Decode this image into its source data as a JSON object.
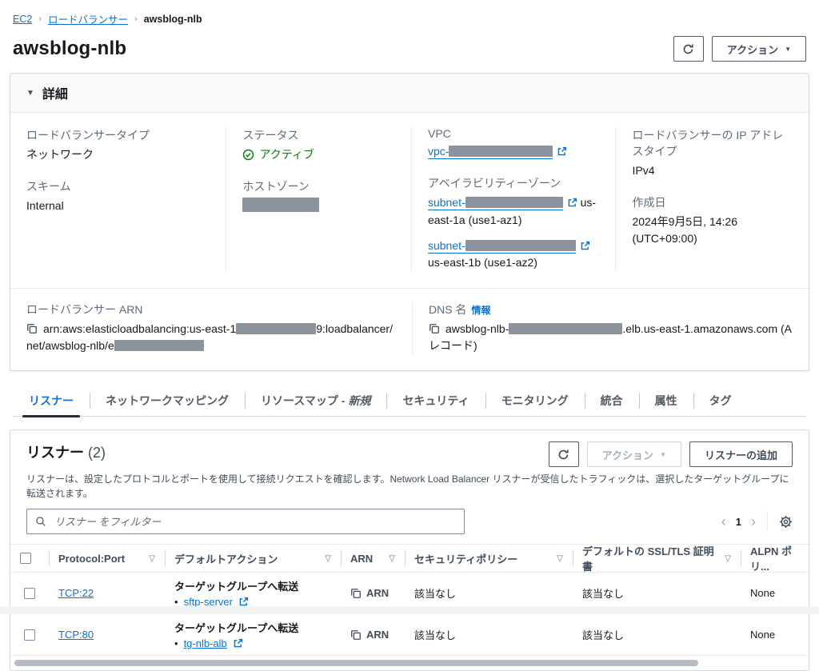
{
  "colors": {
    "link_blue": "#0972d3",
    "status_green": "#037f0c",
    "text_dark": "#16191f",
    "label_gray": "#5f6b7a",
    "border_gray": "#d5dbdb",
    "redact_gray": "#8c939c",
    "active_tab_underline": "#232f3e"
  },
  "icons": {
    "caret_down": "▼",
    "collapse_triangle": "▼",
    "sort_triangle": "▽",
    "breadcrumb_sep": "›",
    "bullet": "•",
    "chevron_left": "‹",
    "chevron_right": "›"
  },
  "breadcrumb": {
    "items": [
      "EC2",
      "ロードバランサー",
      "awsblog-nlb"
    ]
  },
  "header": {
    "title": "awsblog-nlb",
    "actions_button": "アクション"
  },
  "details": {
    "title": "詳細",
    "lb_type": {
      "label": "ロードバランサータイプ",
      "value": "ネットワーク"
    },
    "scheme": {
      "label": "スキーム",
      "value": "Internal"
    },
    "status": {
      "label": "ステータス",
      "value": "アクティブ"
    },
    "hosted_zone": {
      "label": "ホストゾーン"
    },
    "vpc": {
      "label": "VPC",
      "value_prefix": "vpc-"
    },
    "az": {
      "label": "アベイラビリティーゾーン",
      "subnet1_prefix": "subnet-",
      "subnet1_suffix": "us-east-1a (use1-az1)",
      "subnet2_prefix": "subnet-",
      "subnet2_suffix": "us-east-1b (use1-az2)"
    },
    "ip_type": {
      "label": "ロードバランサーの IP アドレスタイプ",
      "value": "IPv4"
    },
    "created": {
      "label": "作成日",
      "value": "2024年9月5日, 14:26 (UTC+09:00)"
    },
    "arn": {
      "label": "ロードバランサー ARN",
      "value_part1": "arn:aws:elasticloadbalancing:us-east-1",
      "value_part2": "9:loadbalancer/net/awsblog-nlb/e"
    },
    "dns": {
      "label": "DNS 名",
      "info_link": "情報",
      "value_prefix": "awsblog-nlb-",
      "value_suffix": ".elb.us-east-1.amazonaws.com (A レコード)"
    }
  },
  "tabs": [
    {
      "label": "リスナー"
    },
    {
      "label": "ネットワークマッピング"
    },
    {
      "label": "リソースマップ -",
      "label_em": "新規"
    },
    {
      "label": "セキュリティ"
    },
    {
      "label": "モニタリング"
    },
    {
      "label": "統合"
    },
    {
      "label": "属性"
    },
    {
      "label": "タグ"
    }
  ],
  "listeners": {
    "title": "リスナー",
    "count": "(2)",
    "description": "リスナーは、設定したプロトコルとポートを使用して接続リクエストを確認します。Network Load Balancer リスナーが受信したトラフィックは、選択したターゲットグループに転送されます。",
    "actions_button": "アクション",
    "add_button": "リスナーの追加",
    "filter_placeholder": "リスナー をフィルター",
    "pagination": {
      "page": "1"
    },
    "table": {
      "headers": [
        "Protocol:Port",
        "デフォルトアクション",
        "ARN",
        "セキュリティポリシー",
        "デフォルトの SSL/TLS 証明書",
        "ALPN ポリ..."
      ],
      "rows": [
        {
          "protocol": "TCP:22",
          "action": "ターゲットグループへ転送",
          "target": "sftp-server",
          "arn": "ARN",
          "security_policy": "該当なし",
          "ssl_cert": "該当なし",
          "alpn": "None"
        },
        {
          "protocol": "TCP:80",
          "action": "ターゲットグループへ転送",
          "target": "tg-nlb-alb",
          "arn": "ARN",
          "security_policy": "該当なし",
          "ssl_cert": "該当なし",
          "alpn": "None"
        }
      ]
    }
  }
}
